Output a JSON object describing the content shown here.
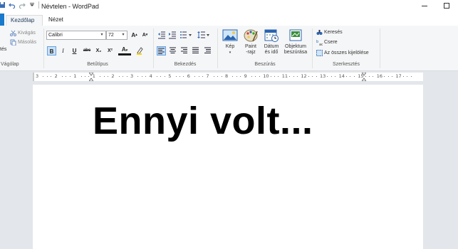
{
  "window": {
    "title": "Névtelen - WordPad",
    "min_label": "—",
    "max_label": "☐"
  },
  "tabs": {
    "home": "Kezdőlap",
    "view": "Nézet"
  },
  "clipboard": {
    "group_label": "Vágólap",
    "paste_partial": "tés",
    "cut": "Kivágás",
    "copy": "Másolás"
  },
  "font": {
    "group_label": "Betűtípus",
    "family": "Calibri",
    "size": "72",
    "bold": "B",
    "italic": "I",
    "underline": "U",
    "strike": "abc",
    "subscript": "X₂",
    "superscript": "X²",
    "color": "A",
    "grow": "A",
    "shrink": "A"
  },
  "paragraph": {
    "group_label": "Bekezdés"
  },
  "insert": {
    "group_label": "Beszúrás",
    "picture": "Kép",
    "paint_1": "Paint",
    "paint_2": "-rajz",
    "datetime_1": "Dátum",
    "datetime_2": "és idő",
    "object_1": "Objektum",
    "object_2": "beszúrása"
  },
  "editing": {
    "group_label": "Szerkesztés",
    "find": "Keresés",
    "replace": "Csere",
    "select_all": "Az összes kijelölése"
  },
  "ruler": {
    "numbers": [
      "3",
      "2",
      "1",
      "1",
      "2",
      "3",
      "4",
      "5",
      "6",
      "7",
      "8",
      "9",
      "10",
      "11",
      "12",
      "13",
      "14",
      "15",
      "16",
      "17"
    ]
  },
  "document": {
    "text": "Ennyi volt..."
  },
  "colors": {
    "accent": "#1979ca",
    "ribbon_bg": "#f5f6f7",
    "workspace_bg": "#e3e6ea"
  }
}
